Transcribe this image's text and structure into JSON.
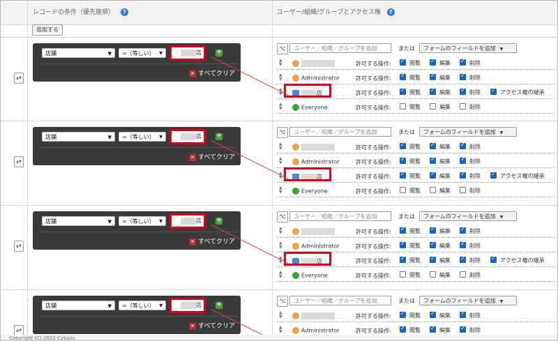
{
  "header": {
    "conditions_title": "レコードの条件（優先度順）",
    "acl_title": "ユーザー/組織/グループとアクセス権",
    "help_icon": "?"
  },
  "toolbar": {
    "add_label": "追加する"
  },
  "condition": {
    "field_label": "店舗",
    "operator_label": "=（等しい）",
    "value_suffix": "店",
    "clear_label": "すべてクリア"
  },
  "acl": {
    "entity_placeholder": "ユーザー／組織／グループを追加",
    "or_label": "または",
    "form_field_label": "フォームのフィールドを追加",
    "permission_label": "許可する操作:",
    "view_label": "閲覧",
    "edit_label": "編集",
    "delete_label": "削除",
    "inherit_label": "アクセス権の継承",
    "admin_name": "Administrator",
    "org_suffix": "店",
    "everyone_name": "Everyone"
  },
  "rows": [
    {
      "entities": [
        {
          "type": "user",
          "name": "",
          "v": true,
          "e": true,
          "d": true,
          "inherit": null
        },
        {
          "type": "user",
          "name": "Administrator",
          "v": true,
          "e": true,
          "d": true,
          "inherit": null
        },
        {
          "type": "org",
          "name": "店",
          "v": true,
          "e": true,
          "d": true,
          "inherit": true
        },
        {
          "type": "group",
          "name": "Everyone",
          "v": false,
          "e": false,
          "d": false,
          "inherit": null
        }
      ]
    },
    {
      "entities": [
        {
          "type": "user",
          "name": "",
          "v": true,
          "e": true,
          "d": true,
          "inherit": null
        },
        {
          "type": "user",
          "name": "Administrator",
          "v": true,
          "e": true,
          "d": true,
          "inherit": null
        },
        {
          "type": "org",
          "name": "店",
          "v": true,
          "e": true,
          "d": true,
          "inherit": true
        },
        {
          "type": "group",
          "name": "Everyone",
          "v": false,
          "e": false,
          "d": false,
          "inherit": null
        }
      ]
    },
    {
      "entities": [
        {
          "type": "user",
          "name": "",
          "v": true,
          "e": true,
          "d": true,
          "inherit": null
        },
        {
          "type": "user",
          "name": "Administrator",
          "v": true,
          "e": true,
          "d": true,
          "inherit": null
        },
        {
          "type": "org",
          "name": "店",
          "v": true,
          "e": true,
          "d": true,
          "inherit": true
        },
        {
          "type": "group",
          "name": "Everyone",
          "v": false,
          "e": false,
          "d": false,
          "inherit": null
        }
      ]
    },
    {
      "entities": [
        {
          "type": "user",
          "name": "",
          "v": true,
          "e": true,
          "d": true,
          "inherit": null
        },
        {
          "type": "user",
          "name": "Administrator",
          "v": true,
          "e": true,
          "d": true,
          "inherit": null
        }
      ]
    }
  ],
  "footer": {
    "copyright": "Copyright (C) 2022 Cybozu"
  },
  "colors": {
    "highlight": "#e0001b",
    "checkbox": "#1664c3",
    "condition_bg": "#3a3a3a"
  }
}
